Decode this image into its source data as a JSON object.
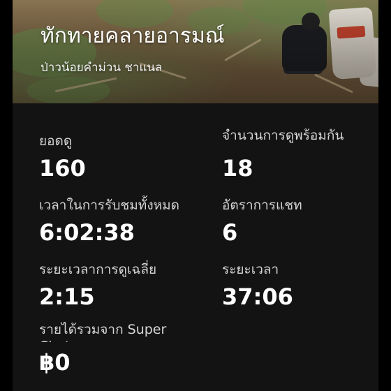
{
  "stream": {
    "title": "ทักทายคลายอารมณ์",
    "channel": "ป่าวน้อยคำม่วน ชาแนล"
  },
  "stats": {
    "views": {
      "label": "ยอดดู",
      "value": "160"
    },
    "concurrent": {
      "label": "จำนวนการดูพร้อมกัน",
      "value": "18"
    },
    "total_watch_time": {
      "label": "เวลาในการรับชมทั้งหมด",
      "value": "6:02:38"
    },
    "chat_rate": {
      "label": "อัตราการแชท",
      "value": "6"
    },
    "avg_view_duration": {
      "label": "ระยะเวลาการดูเฉลี่ย",
      "value": "2:15"
    },
    "duration": {
      "label": "ระยะเวลา",
      "value": "37:06"
    },
    "super_chat_revenue": {
      "label": "รายได้รวมจาก Super Chat",
      "value": "฿0"
    }
  },
  "colors": {
    "card_background": "#131313",
    "page_background": "#000000",
    "label_text": "#d6d6d6",
    "value_text": "#ffffff"
  }
}
